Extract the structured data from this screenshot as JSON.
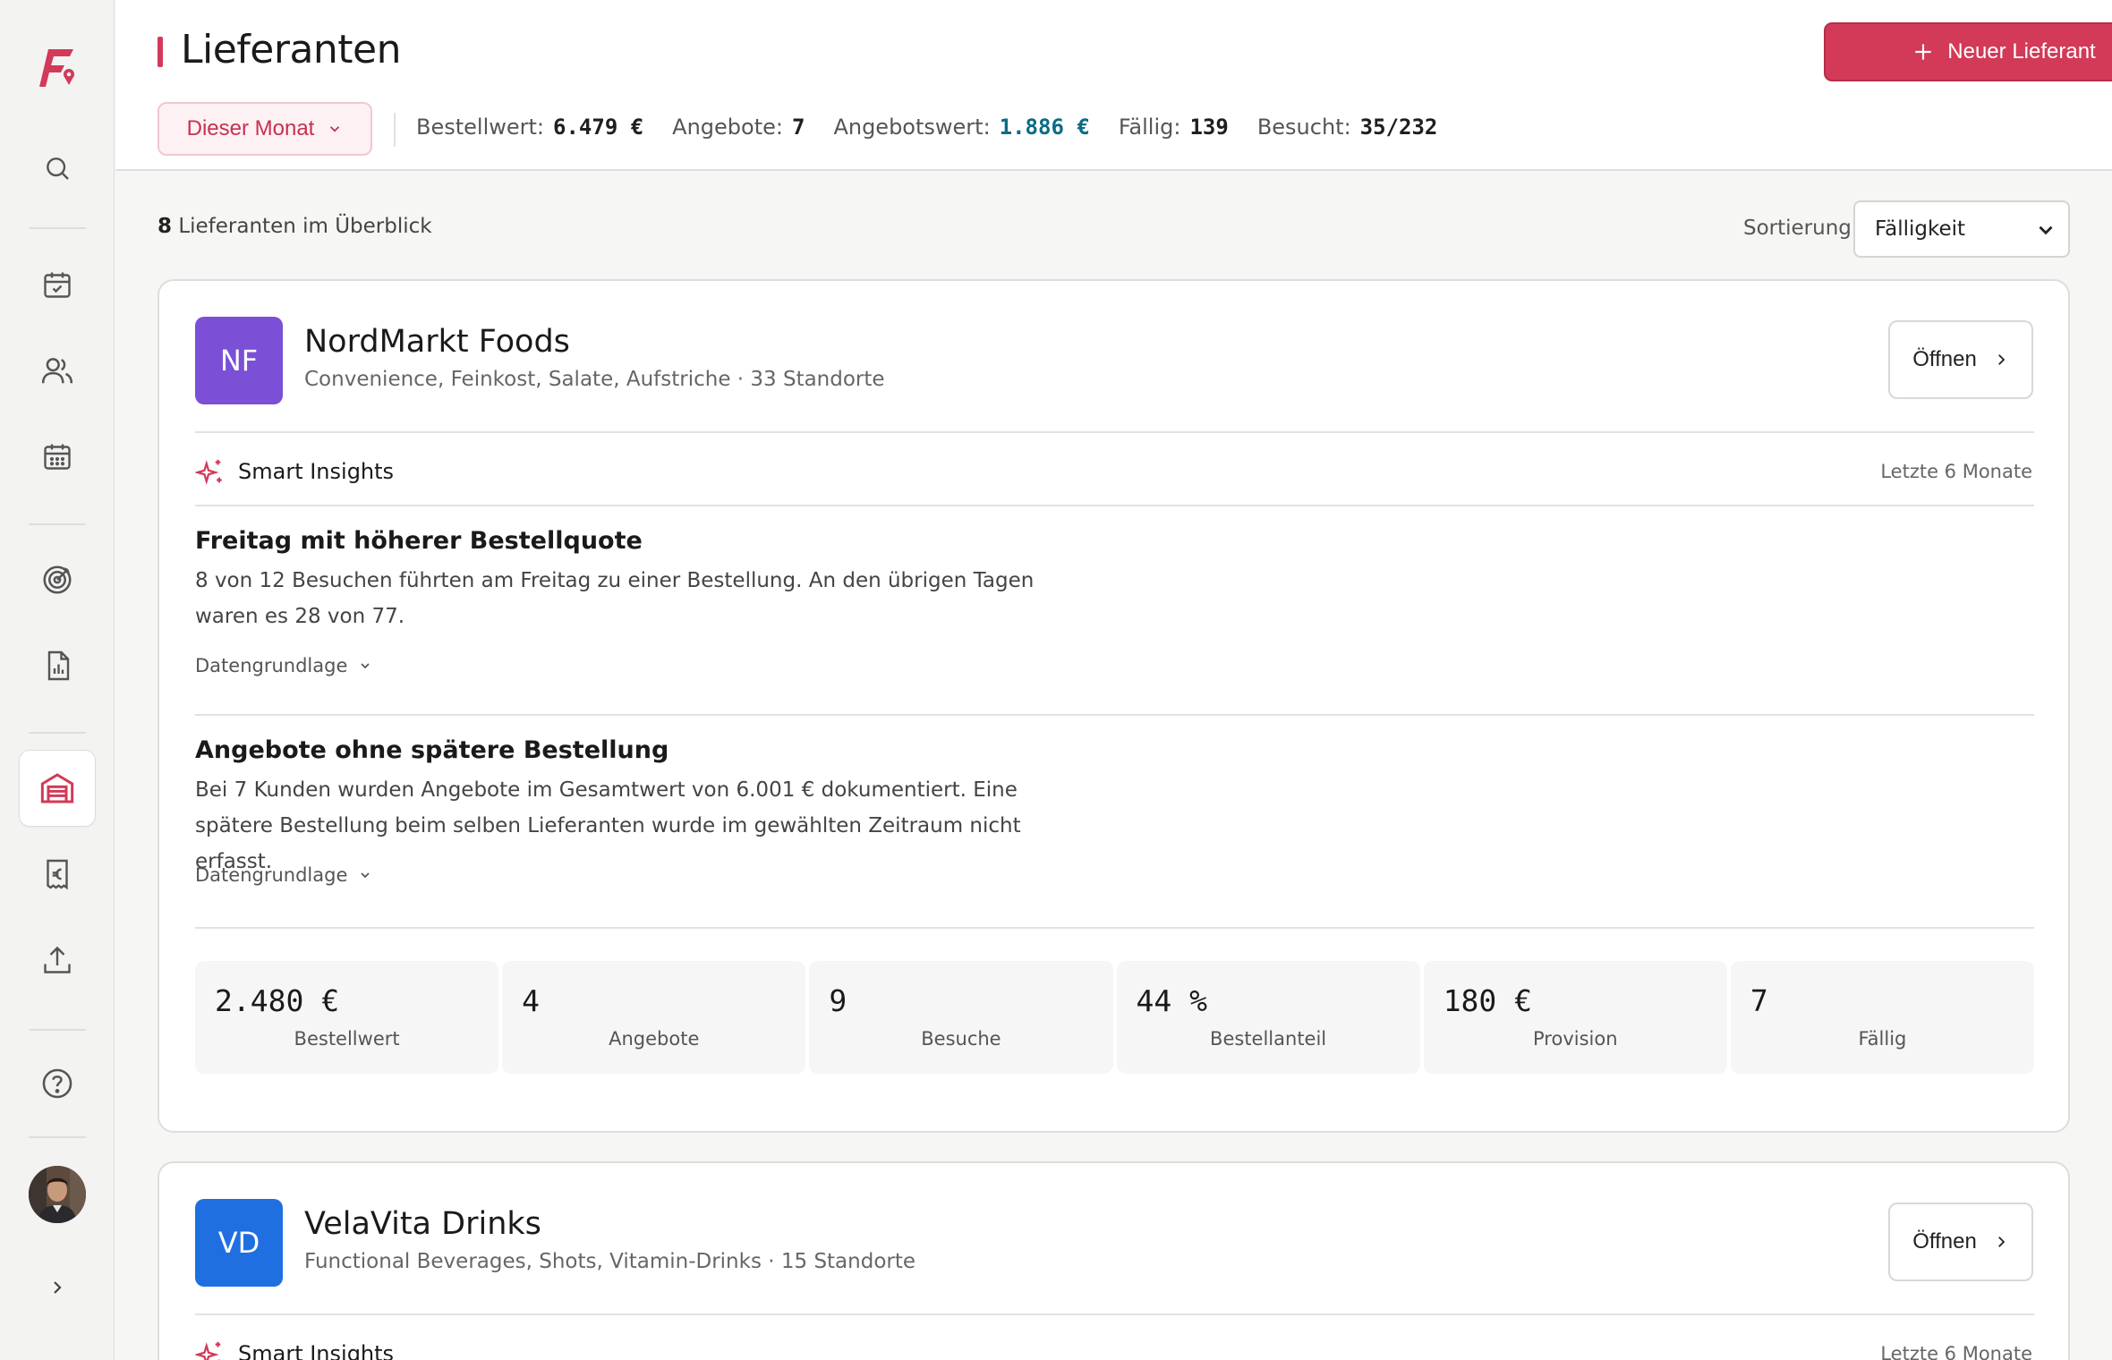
{
  "header": {
    "title": "Lieferanten",
    "new_button": "Neuer Lieferant",
    "period": "Dieser Monat",
    "stats": [
      {
        "label": "Bestellwert:",
        "value": "6.479 €"
      },
      {
        "label": "Angebote:",
        "value": "7"
      },
      {
        "label": "Angebotswert:",
        "value": "1.886 €"
      },
      {
        "label": "Fällig:",
        "value": "139"
      },
      {
        "label": "Besucht:",
        "value": "35/232"
      }
    ]
  },
  "toolbar": {
    "count": "8",
    "count_suffix": "Lieferanten im Überblick",
    "sort_label": "Sortierung",
    "sort_value": "Fälligkeit"
  },
  "colors": {
    "accent": "#d23a58",
    "accent_teal": "#0d6b86",
    "logo_nf": "#7b4fd6",
    "logo_vd": "#1f6fe0"
  },
  "suppliers": [
    {
      "initials": "NF",
      "name": "NordMarkt Foods",
      "subtitle": "Convenience, Feinkost, Salate, Aufstriche · 33 Standorte",
      "open_label": "Öffnen",
      "insights_title": "Smart Insights",
      "insights_period": "Letzte 6 Monate",
      "insights": [
        {
          "title": "Freitag mit höherer Bestellquote",
          "text": "8 von 12 Besuchen führten am Freitag zu einer Bestellung. An den übrigen Tagen waren es 28 von 77.",
          "more": "Datengrundlage"
        },
        {
          "title": "Angebote ohne spätere Bestellung",
          "text": "Bei 7 Kunden wurden Angebote im Gesamtwert von 6.001 € dokumentiert. Eine spätere Bestellung beim selben Lieferanten wurde im gewählten Zeitraum nicht erfasst.",
          "more": "Datengrundlage"
        }
      ],
      "metrics": [
        {
          "value": "2.480 €",
          "label": "Bestellwert"
        },
        {
          "value": "4",
          "label": "Angebote"
        },
        {
          "value": "9",
          "label": "Besuche"
        },
        {
          "value": "44 %",
          "label": "Bestellanteil"
        },
        {
          "value": "180 €",
          "label": "Provision"
        },
        {
          "value": "7",
          "label": "Fällig"
        }
      ]
    },
    {
      "initials": "VD",
      "name": "VelaVita Drinks",
      "subtitle": "Functional Beverages, Shots, Vitamin-Drinks · 15 Standorte",
      "open_label": "Öffnen",
      "insights_title": "Smart Insights",
      "insights_period": "Letzte 6 Monate"
    }
  ],
  "sidebar": {
    "icons": [
      "app-logo",
      "search-icon",
      "calendar-check-icon",
      "users-icon",
      "calendar-icon",
      "target-icon",
      "report-icon",
      "warehouse-icon",
      "euro-receipt-icon",
      "upload-icon",
      "help-icon",
      "avatar",
      "chevron-right-icon"
    ]
  }
}
